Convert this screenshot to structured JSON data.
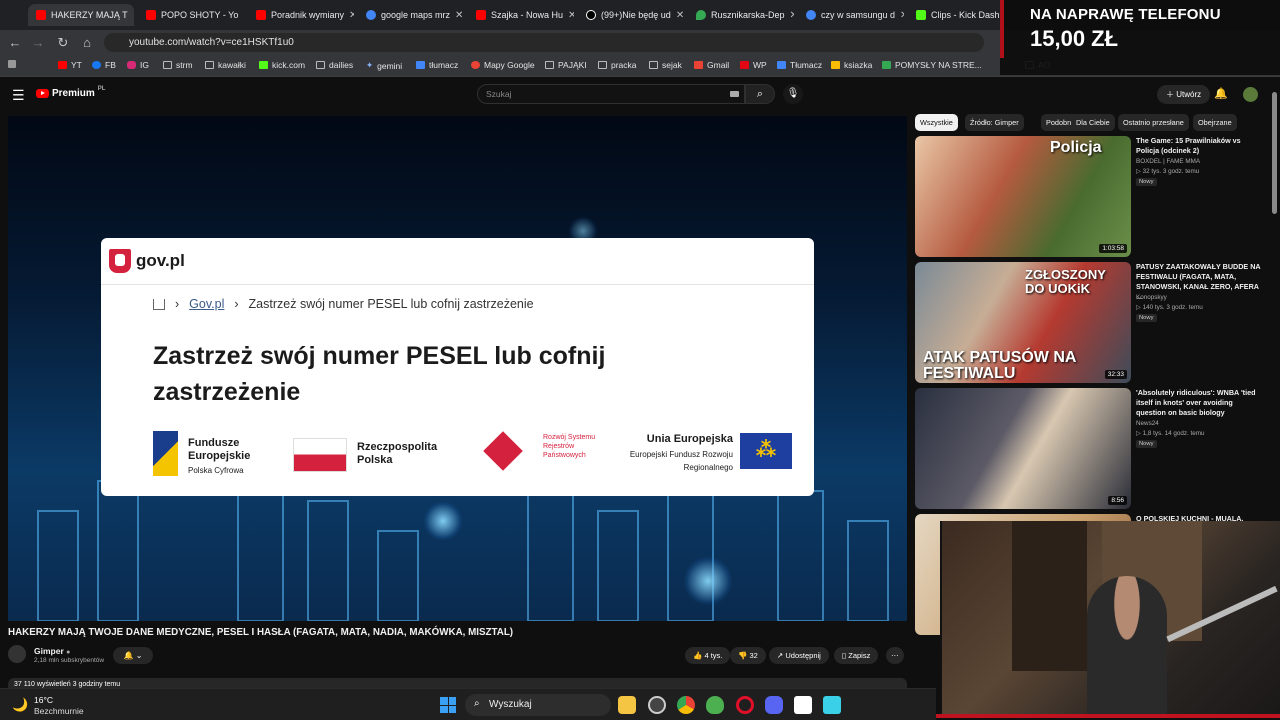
{
  "browser": {
    "tabs": [
      {
        "label": "HAKERZY MAJĄ T",
        "color": "#ff0000",
        "active": true
      },
      {
        "label": "POPO SHOTY - Yo",
        "color": "#ff0000"
      },
      {
        "label": "Poradnik wymiany",
        "color": "#ff0000"
      },
      {
        "label": "google maps mrz",
        "color": "#4285f4"
      },
      {
        "label": "Szajka - Nowa Hu",
        "color": "#ff0000"
      },
      {
        "label": "(99+)Nie będę ud",
        "color": "#ffffff"
      },
      {
        "label": "Rusznikarska-Dep",
        "color": "#34a853"
      },
      {
        "label": "czy w samsungu d",
        "color": "#4285f4"
      },
      {
        "label": "Clips - Kick Dashb",
        "color": "#53fc18"
      }
    ],
    "url": "youtube.com/watch?v=ce1HSKTf1u0",
    "bookmarks": [
      "YT",
      "FB",
      "IG",
      "strm",
      "kawałki",
      "kick.com",
      "dailies",
      "gemini",
      "tłumacz",
      "Mapy Google",
      "PAJĄKI",
      "pracka",
      "sejak",
      "Gmail",
      "WP",
      "Tłumacz",
      "ksiazka",
      "POMYSŁY NA STRE...",
      "AO"
    ]
  },
  "overlay": {
    "line1": "NA NAPRAWĘ TELEFONU",
    "line2": "15,00 ZŁ"
  },
  "youtube": {
    "logo_label": "Premium",
    "region": "PL",
    "search_placeholder": "Szukaj",
    "create_label": "Utwórz",
    "video": {
      "gov_logo": "gov.pl",
      "breadcrumb_link": "Gov.pl",
      "breadcrumb_current": "Zastrzeż swój numer PESEL lub cofnij zastrzeżenie",
      "gov_title": "Zastrzeż swój numer PESEL lub cofnij zastrzeżenie",
      "logos": {
        "fe_title": "Fundusze Europejskie",
        "fe_sub": "Polska Cyfrowa",
        "rp": "Rzeczpospolita Polska",
        "rsrp": "Rozwój Systemu Rejestrów Państwowych",
        "ue_title": "Unia Europejska",
        "ue_sub": "Europejski Fundusz Rozwoju Regionalnego"
      },
      "title": "HAKERZY MAJĄ TWOJE DANE MEDYCZNE, PESEL I HASŁA (FAGATA, MATA, NADIA, MAKÓWKA, MISZTAL)",
      "channel": "Gimper",
      "subscribers": "2,18 mln subskrybentów",
      "likes": "4 tys.",
      "comments": "32",
      "share_label": "Udostępnij",
      "save_label": "Zapisz",
      "views": "37 110 wyświetleń  3 godziny temu"
    },
    "chips": [
      "Wszystkie",
      "Źródło: Gimper",
      "Podobne",
      "Dla Ciebie",
      "Ostatnio przesłane",
      "Obejrzane"
    ],
    "recommendations": [
      {
        "title": "The Game: 15 Prawilniaków vs Policja (odcinek 2)",
        "channel": "BOXDEL | FAME MMA",
        "meta": "32 tys.  3 godz. temu",
        "badge": "Nowy",
        "duration": "1:03:58",
        "thumb_text": "Policja"
      },
      {
        "title": "PATUSY ZAATAKOWAŁY BUDDE NA FESTIWALU (FAGATA, MATA, STANOWSKI, KANAŁ ZERO, AFERA ...",
        "channel": "Konopskyy",
        "meta": "140 tys.  3 godz. temu",
        "badge": "Nowy",
        "duration": "32:33",
        "thumb_text": "ATAK PATUSÓW NA FESTIWALU",
        "thumb_text2": "ZGŁOSZONY DO UOKiK"
      },
      {
        "title": "'Absolutely ridiculous': WNBA 'tied itself in knots' over avoiding question on basic biology",
        "channel": "News24",
        "meta": "1,8 tys.  14 godz. temu",
        "badge": "Nowy",
        "duration": "8:56"
      },
      {
        "title": "O POLSKIEJ KUCHNI - MUALA,"
      }
    ]
  },
  "taskbar": {
    "temp": "16°C",
    "condition": "Bezchmurnie",
    "search_label": "Wyszukaj"
  }
}
